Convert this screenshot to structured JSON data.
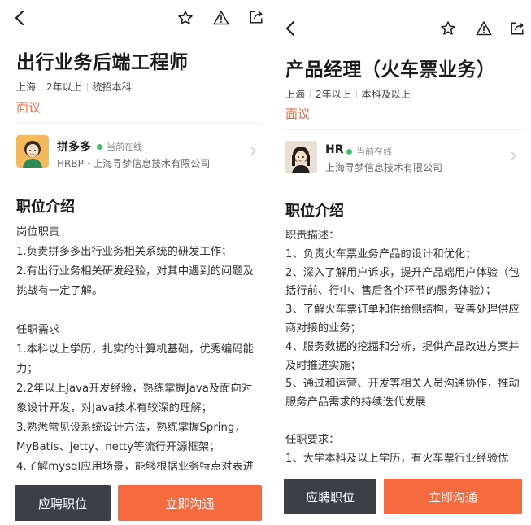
{
  "left": {
    "title": "出行业务后端工程师",
    "meta": [
      "上海",
      "2年以上",
      "统招本科"
    ],
    "salary": "面议",
    "contact": {
      "name": "拼多多",
      "status": "当前在线",
      "company": "HRBP · 上海寻梦信息技术有限公司"
    },
    "section_title": "职位介绍",
    "description": [
      "岗位职责",
      "1.负责拼多多出行业务相关系统的研发工作；",
      "2.有出行业务相关研发经验，对其中遇到的问题及",
      "挑战有一定了解。",
      "",
      "任职需求",
      "1.本科以上学历，扎实的计算机基础，优秀编码能",
      "力；",
      "2.2年以上Java开发经验，熟练掌握Java及面向对",
      "象设计开发，对Java技术有较深的理解；",
      "3.熟悉常见设系统设计方法，熟练掌握Spring，",
      "MyBatis、jetty、netty等流行开源框架；",
      "4.了解mysql应用场景，能够根据业务特点对表进"
    ],
    "buttons": {
      "apply": "应聘职位",
      "chat": "立即沟通"
    }
  },
  "right": {
    "title": "产品经理（火车票业务）",
    "meta": [
      "上海",
      "2年以上",
      "本科及以上"
    ],
    "salary": "面议",
    "contact": {
      "name": "HR",
      "status": "当前在线",
      "company": "上海寻梦信息技术有限公司"
    },
    "section_title": "职位介绍",
    "description": [
      "职责描述：",
      "1、负责火车票业务产品的设计和优化；",
      "2、深入了解用户诉求，提升产品端用户体验（包",
      "括行前、行中、售后各个环节的服务体验）；",
      "3、了解火车票订单和供给侧结构，妥善处理供应",
      "商对接的业务；",
      "4、服务数据的挖掘和分析，提供产品改进方案并",
      "及时推进实施；",
      "5、通过和运营、开发等相关人员沟通协作，推动",
      "服务产品需求的持续迭代发展",
      "",
      "任职要求：",
      "1、大学本科及以上学历，有火车票行业经验优"
    ],
    "buttons": {
      "apply": "应聘职位",
      "chat": "立即沟通"
    }
  },
  "colors": {
    "accent": "#f26a3d",
    "button_dark": "#3d3f47",
    "button_orange": "#f56a3f",
    "online_dot": "#3fc26b"
  },
  "icons": [
    "back-arrow-icon",
    "star-icon",
    "warning-icon",
    "share-icon",
    "chevron-right-icon"
  ]
}
